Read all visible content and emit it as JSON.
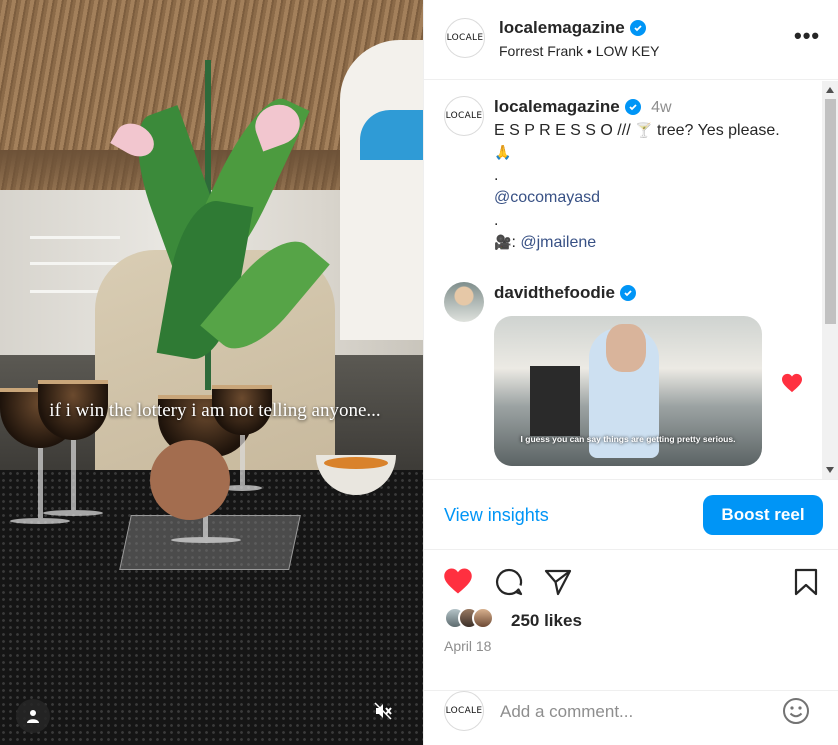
{
  "media": {
    "caption": "if i win the lottery i am not telling anyone..."
  },
  "header": {
    "logo_text": "LOCALE",
    "username": "localemagazine",
    "audio": "Forrest Frank • LOW KEY",
    "more_icon": "more-horizontal-icon"
  },
  "caption_comment": {
    "logo_text": "LOCALE",
    "username": "localemagazine",
    "time": "4w",
    "line1_text": "E S P R E S S O /// ",
    "line1_emoji": "🍸",
    "line1_rest": " tree? Yes please.",
    "line2_emoji": "🙏",
    "dot1": ".",
    "mention1": "@cocomayasd",
    "dot2": ".",
    "camera_emoji": "🎥",
    "mention2_prefix": ": ",
    "mention2": "@jmailene"
  },
  "reply_comment": {
    "username": "davidthefoodie",
    "gif_caption": "I guess you can say things are getting pretty serious."
  },
  "insights": {
    "view_label": "View insights",
    "boost_label": "Boost reel"
  },
  "actions": {
    "likes": "250 likes",
    "date": "April 18"
  },
  "add_comment": {
    "logo_text": "LOCALE",
    "placeholder": "Add a comment..."
  },
  "colors": {
    "accent": "#0095f6",
    "like_red": "#ff3040",
    "link": "#385185"
  }
}
